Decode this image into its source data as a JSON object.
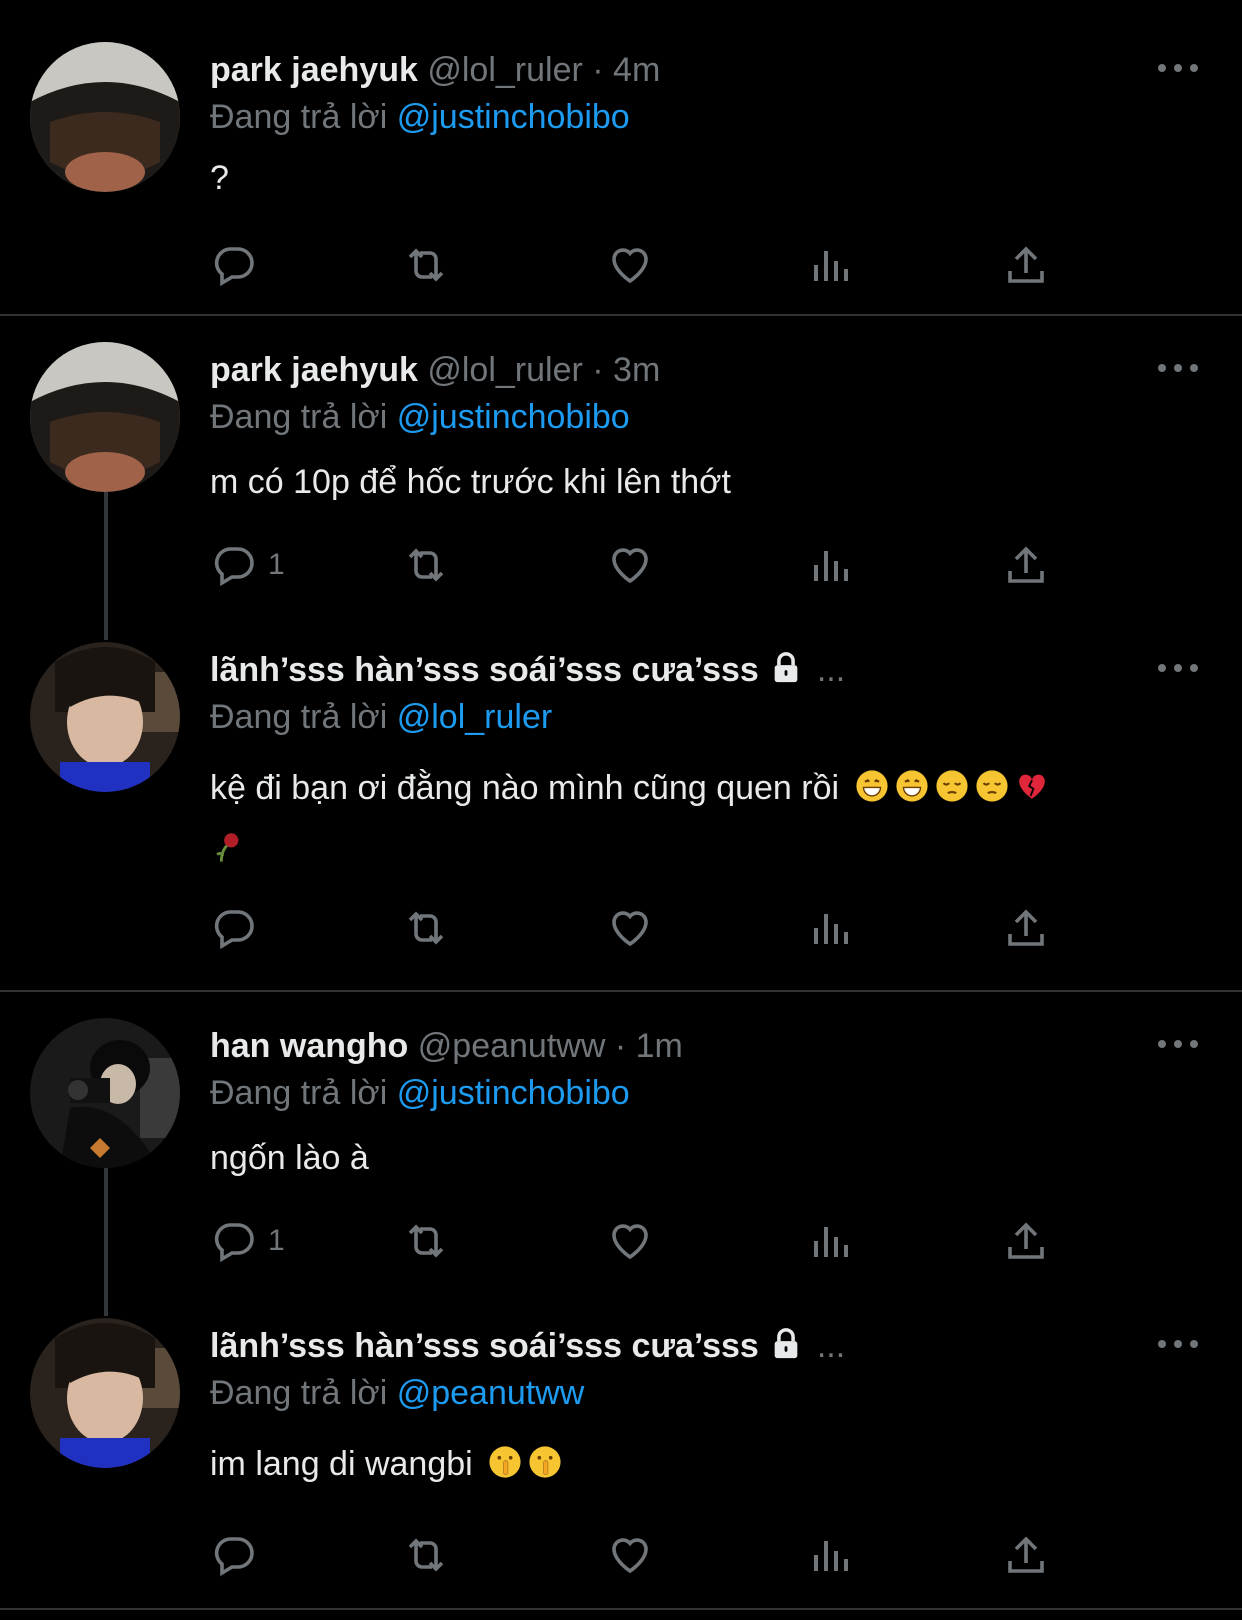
{
  "colors": {
    "background": "#000000",
    "text": "#e7e9ea",
    "muted": "#71767b",
    "link": "#1d9bf0",
    "divider": "#2f3336"
  },
  "tweets": [
    {
      "name": "park jaehyuk",
      "handle": "@lol_ruler",
      "sep": "·",
      "time": "4m",
      "reply_label": "Đang trả lời",
      "reply_to": "@justinchobibo",
      "text": "?",
      "reply_count": "",
      "avatar": "avatar-cap-boy"
    },
    {
      "name": "park jaehyuk",
      "handle": "@lol_ruler",
      "sep": "·",
      "time": "3m",
      "reply_label": "Đang trả lời",
      "reply_to": "@justinchobibo",
      "text": "m có 10p để hốc trước khi lên thớt",
      "reply_count": "1",
      "avatar": "avatar-cap-boy"
    },
    {
      "name": "lãnh’sss hàn’sss soái’sss cưa’sss",
      "handle": "",
      "ellipsis": "...",
      "reply_label": "Đang trả lời",
      "reply_to": "@lol_ruler",
      "text": "kệ đi bạn ơi đằng nào mình cũng quen rồi",
      "emojis": [
        "grinning-face",
        "grinning-face",
        "pensive-face",
        "pensive-face",
        "broken-heart",
        "wilted-flower"
      ],
      "reply_count": "",
      "avatar": "avatar-emo-boy",
      "locked": true
    },
    {
      "name": "han wangho",
      "handle": "@peanutww",
      "sep": "·",
      "time": "1m",
      "reply_label": "Đang trả lời",
      "reply_to": "@justinchobibo",
      "text": "ngốn lào à",
      "reply_count": "1",
      "avatar": "avatar-camera-boy"
    },
    {
      "name": "lãnh’sss hàn’sss soái’sss cưa’sss",
      "handle": "",
      "ellipsis": "...",
      "reply_label": "Đang trả lời",
      "reply_to": "@peanutww",
      "text": "im lang di wangbi",
      "emojis": [
        "shushing-face",
        "shushing-face"
      ],
      "reply_count": "",
      "avatar": "avatar-emo-boy",
      "locked": true
    }
  ],
  "icons": [
    "reply-icon",
    "retweet-icon",
    "like-icon",
    "views-icon",
    "share-icon",
    "more-icon",
    "lock-icon"
  ]
}
